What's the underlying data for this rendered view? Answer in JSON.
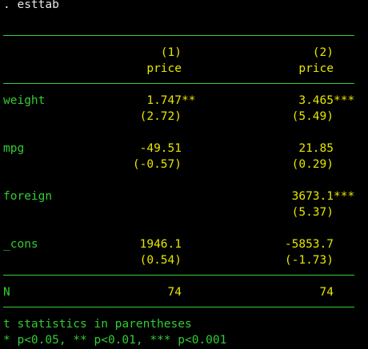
{
  "command": ". esttab",
  "header": {
    "model_numbers": [
      "(1)",
      "(2)"
    ],
    "depvars": [
      "price",
      "price"
    ]
  },
  "rows": [
    {
      "var": "weight",
      "coef": [
        "1.747",
        "3.465"
      ],
      "stars": [
        "**",
        "***"
      ],
      "tstat": [
        "(2.72)",
        "(5.49)"
      ]
    },
    {
      "var": "mpg",
      "coef": [
        "-49.51",
        "21.85"
      ],
      "stars": [
        "",
        ""
      ],
      "tstat": [
        "(-0.57)",
        "(0.29)"
      ]
    },
    {
      "var": "foreign",
      "coef": [
        "",
        "3673.1"
      ],
      "stars": [
        "",
        "***"
      ],
      "tstat": [
        "",
        "(5.37)"
      ]
    },
    {
      "var": "_cons",
      "coef": [
        "1946.1",
        "-5853.7"
      ],
      "stars": [
        "",
        ""
      ],
      "tstat": [
        "(0.54)",
        "(-1.73)"
      ]
    }
  ],
  "n_row": {
    "label": "N",
    "values": [
      "74",
      "74"
    ]
  },
  "footnote": {
    "line1": "t statistics in parentheses",
    "line2": "* p<0.05, ** p<0.01, *** p<0.001"
  }
}
